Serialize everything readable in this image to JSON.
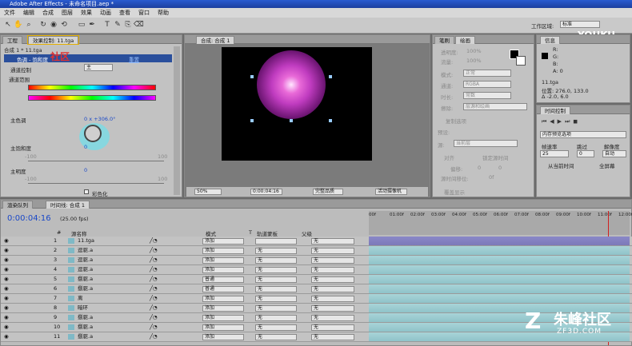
{
  "window_title": "Adobe After Effects - 未命名项目.aep *",
  "menu": [
    "文件",
    "编辑",
    "合成",
    "图层",
    "效果",
    "动画",
    "查看",
    "窗口",
    "帮助"
  ],
  "workspace": {
    "label": "工作区域:",
    "value": "标准"
  },
  "watermark": {
    "youku": "YOUKU",
    "youku_cn": "优酷",
    "zf3d_cn": "朱峰社区",
    "zf3d_url": "ZF3D.COM",
    "effect_overlay": "社区"
  },
  "effects_panel": {
    "tabs": [
      "工程",
      "效果控制: 11.tga"
    ],
    "header": "合成 1 * 11.tga",
    "effect_name": "色调 - 饱和度",
    "reset_label": "重置",
    "channel_control_label": "通道控制",
    "channel_control_value": "主",
    "channel_range_label": "通道范围",
    "hue_label": "主色调",
    "hue_value": "0 x +306.0°",
    "saturation_label": "主饱和度",
    "saturation_value": "0",
    "sat_min": "-100",
    "sat_max": "100",
    "lightness_label": "主明度",
    "lightness_value": "0",
    "light_min": "-100",
    "light_max": "100",
    "colorize_label": "彩色化"
  },
  "comp_panel": {
    "tab": "合成: 合成 1",
    "zoom": "50%",
    "time": "0:00:04:16",
    "quality": "完整品质",
    "camera": "活动摄像机"
  },
  "paragraph_panel": {
    "tabs": [
      "笔刷",
      "绘画"
    ],
    "opacity_label": "透明度:",
    "opacity_value": "100%",
    "flow_label": "流量:",
    "flow_value": "100%",
    "mode_label": "模式:",
    "mode_value": "正常",
    "channel_label": "通道:",
    "channel_value": "RGBA",
    "duration_label": "时长:",
    "duration_value": "常数",
    "erase_label": "擦除:",
    "erase_value": "层源和绘画",
    "clone_label": "复制选项",
    "preset_label": "预设:",
    "source_label": "源:",
    "source_value": "当前层",
    "aligned_label": "对齐",
    "lock_label": "锁定源时间",
    "offset_label": "偏移:",
    "offset_x": "0",
    "offset_y": "0",
    "source_time_label": "源时间移位:",
    "source_time_value": "0f",
    "overlay_label": "覆盖显示"
  },
  "info_panel": {
    "tab": "信息",
    "r": "R:",
    "g": "G:",
    "b": "B:",
    "a": "A: 0",
    "file": "11.tga",
    "position": "位置: 276.0, 133.0",
    "delta": "Δ -2.0, 6.0"
  },
  "time_control": {
    "tab": "时间控制",
    "ram_label": "内存预览选项",
    "fps_label": "帧速率",
    "skip_label": "跳过",
    "res_label": "解像度",
    "fps_value": "25",
    "skip_value": "0",
    "res_value": "自动",
    "from_current": "从当前时间",
    "fullscreen": "全屏幕"
  },
  "timeline": {
    "tabs": [
      "渲染队列",
      "时间线: 合成 1"
    ],
    "time": "0:00:04:16",
    "fps": "(25.00 fps)",
    "col_num": "#",
    "col_source": "源名称",
    "col_mode": "模式",
    "col_t": "T",
    "col_trkmat": "轨道蒙板",
    "col_parent": "父级",
    "ruler": [
      "00f",
      "01:00f",
      "02:00f",
      "03:00f",
      "04:00f",
      "05:00f",
      "06:00f",
      "07:00f",
      "08:00f",
      "09:00f",
      "10:00f",
      "11:00f",
      "12:00f"
    ],
    "current_time_fraction": 0.917,
    "layers": [
      {
        "num": "1",
        "name": "11.tga",
        "mode": "添加",
        "trk": "",
        "parent": "无"
      },
      {
        "num": "2",
        "name": "逗驱.a",
        "mode": "添加",
        "trk": "无",
        "parent": "无"
      },
      {
        "num": "3",
        "name": "逗驱.a",
        "mode": "添加",
        "trk": "无",
        "parent": "无"
      },
      {
        "num": "4",
        "name": "逗驱.a",
        "mode": "添加",
        "trk": "无",
        "parent": "无"
      },
      {
        "num": "5",
        "name": "捌驱.a",
        "mode": "普通",
        "trk": "无",
        "parent": "无"
      },
      {
        "num": "6",
        "name": "捌驱.a",
        "mode": "普通",
        "trk": "无",
        "parent": "无"
      },
      {
        "num": "7",
        "name": "离",
        "mode": "添加",
        "trk": "无",
        "parent": "无"
      },
      {
        "num": "8",
        "name": "暗环",
        "mode": "添加",
        "trk": "无",
        "parent": "无"
      },
      {
        "num": "9",
        "name": "捌驱.a",
        "mode": "添加",
        "trk": "无",
        "parent": "无"
      },
      {
        "num": "10",
        "name": "捌驱.a",
        "mode": "添加",
        "trk": "无",
        "parent": "无"
      },
      {
        "num": "11",
        "name": "捌驱.a",
        "mode": "添加",
        "trk": "无",
        "parent": "无"
      }
    ]
  },
  "colors": {
    "accent": "#1a48c8",
    "title": "#2a5bd1",
    "track": "#8fc3c9",
    "layer1_track": "#7c7ab8",
    "playhead": "#d02020"
  }
}
